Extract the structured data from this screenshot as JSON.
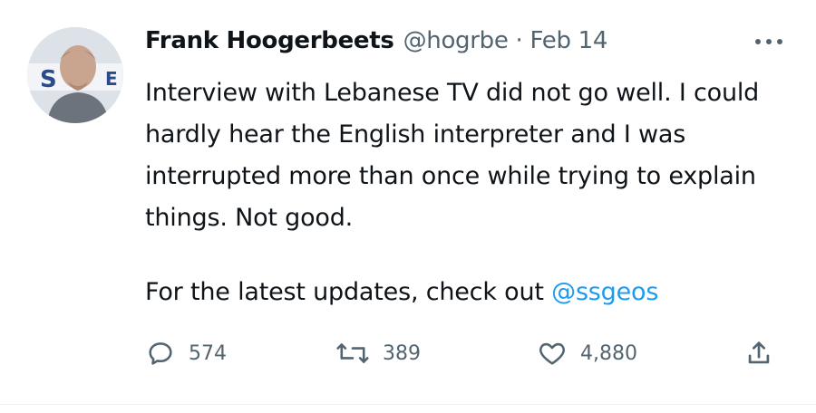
{
  "tweet": {
    "author": {
      "display_name": "Frank Hoogerbeets",
      "handle": "@hogrbe",
      "separator": "·",
      "date": "Feb 14",
      "avatar_icon": "profile-photo"
    },
    "text_paragraph_1": "Interview with Lebanese TV did not go well. I could hardly hear the English interpreter and I was interrupted more than once while trying to explain things. Not good.",
    "text_paragraph_2_prefix": "For the latest updates, check out ",
    "text_paragraph_2_mention": "@ssgeos",
    "actions": {
      "reply": {
        "icon": "reply-icon",
        "count": "574"
      },
      "retweet": {
        "icon": "retweet-icon",
        "count": "389"
      },
      "like": {
        "icon": "heart-icon",
        "count": "4,880"
      },
      "share": {
        "icon": "share-icon"
      }
    },
    "more_icon": "more-options-icon"
  },
  "colors": {
    "text": "#0f1419",
    "secondary": "#536471",
    "mention": "#1d9bf0"
  }
}
